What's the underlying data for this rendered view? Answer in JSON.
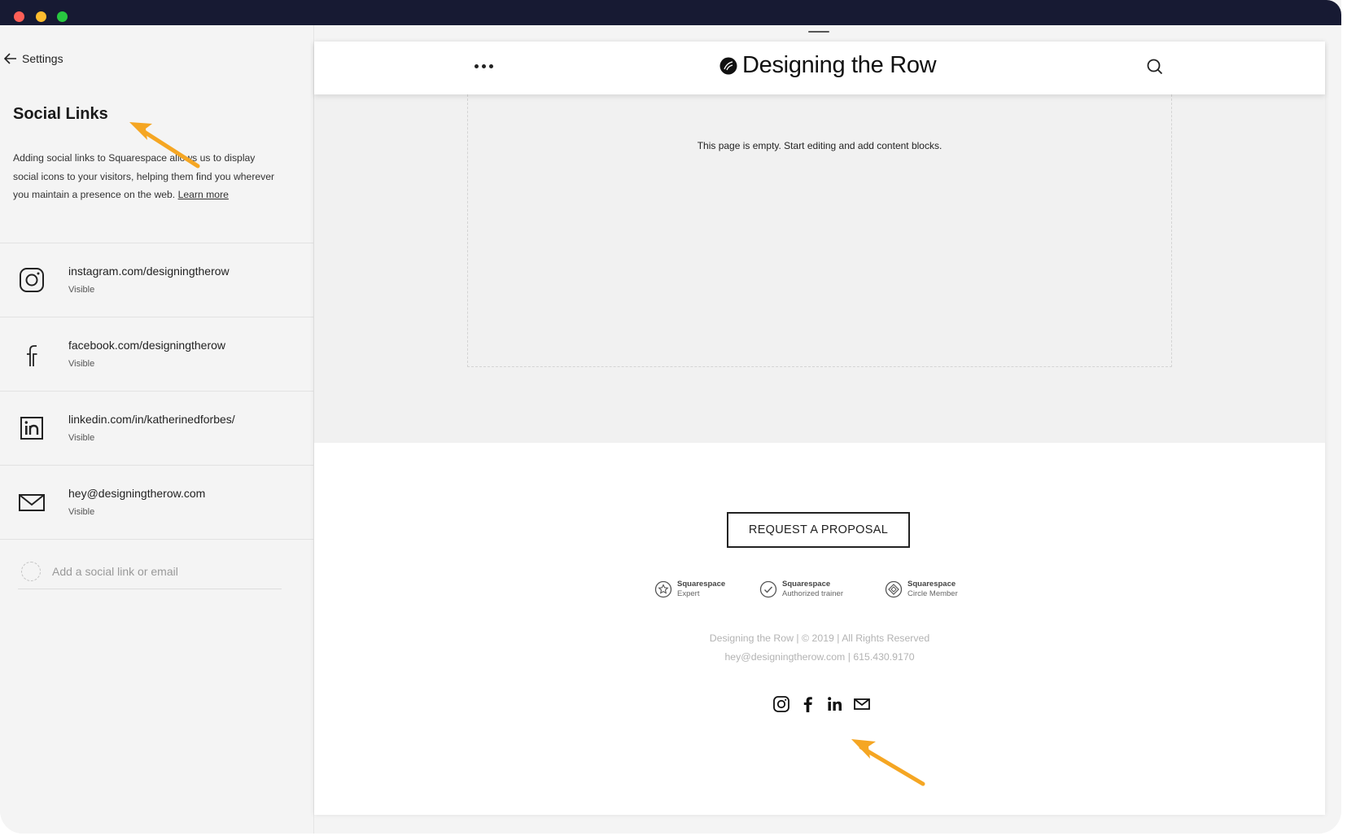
{
  "window": {
    "traffic_lights": [
      "close",
      "minimize",
      "maximize"
    ]
  },
  "sidebar": {
    "back_label": "Settings",
    "title": "Social Links",
    "description": "Adding social links to Squarespace allows us to display social icons to your visitors, helping them find you wherever you maintain a presence on the web.",
    "learn_more": "Learn more",
    "links": [
      {
        "icon": "instagram-icon",
        "url": "instagram.com/designingtherow",
        "status": "Visible"
      },
      {
        "icon": "facebook-icon",
        "url": "facebook.com/designingtherow",
        "status": "Visible"
      },
      {
        "icon": "linkedin-icon",
        "url": "linkedin.com/in/katherinedforbes/",
        "status": "Visible"
      },
      {
        "icon": "email-icon",
        "url": "hey@designingtherow.com",
        "status": "Visible"
      }
    ],
    "add_placeholder": "Add a social link or email"
  },
  "site": {
    "title": "Designing the Row",
    "empty_message": "This page is empty. Start editing and add content blocks.",
    "cta": "REQUEST A PROPOSAL",
    "badges": [
      {
        "icon": "star-badge-icon",
        "line1": "Squarespace",
        "line2": "Expert"
      },
      {
        "icon": "check-badge-icon",
        "line1": "Squarespace",
        "line2": "Authorized trainer"
      },
      {
        "icon": "diamond-badge-icon",
        "line1": "Squarespace",
        "line2": "Circle Member"
      }
    ],
    "footer_line1": "Designing the Row | © 2019 | All Rights Reserved",
    "footer_line2": "hey@designingtherow.com | 615.430.9170",
    "footer_social": [
      "instagram-icon",
      "facebook-icon",
      "linkedin-icon",
      "email-icon"
    ]
  },
  "colors": {
    "accent_arrow": "#f5a623",
    "titlebar": "#171a33"
  }
}
